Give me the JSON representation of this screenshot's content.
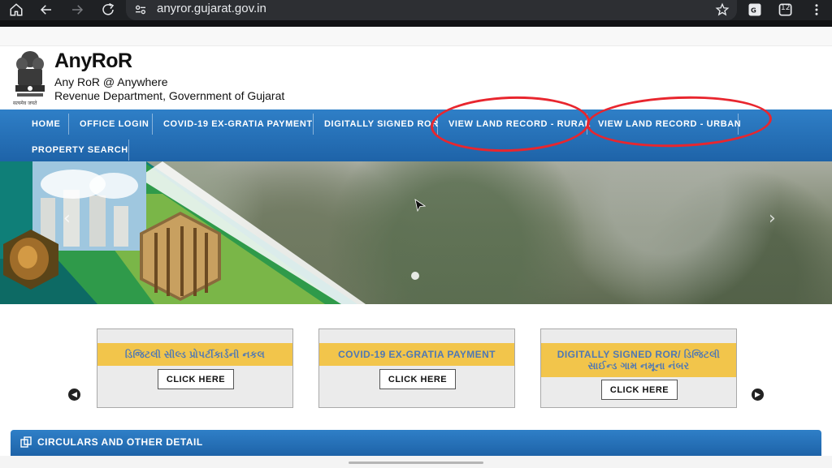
{
  "browser": {
    "url": "anyror.gujarat.gov.in",
    "tab_count": "12"
  },
  "header": {
    "title": "AnyRoR",
    "subtitle1": "Any RoR @ Anywhere",
    "subtitle2": "Revenue Department, Government of Gujarat",
    "emblem_caption": "सत्यमेव जयते"
  },
  "nav": {
    "items": [
      {
        "label": "HOME"
      },
      {
        "label": "OFFICE LOGIN"
      },
      {
        "label": "COVID-19 EX-GRATIA PAYMENT"
      },
      {
        "label": "DIGITALLY SIGNED ROR"
      },
      {
        "label": "VIEW LAND RECORD - RURAL"
      },
      {
        "label": "VIEW LAND RECORD - URBAN"
      },
      {
        "label": "PROPERTY SEARCH"
      }
    ],
    "highlight_color": "#e8262e"
  },
  "banner": {
    "prev_icon": "chevron-left-icon",
    "next_icon": "chevron-right-icon"
  },
  "cards": [
    {
      "title": "ડિજિટલી સીલ્ડ પ્રોપર્ટીકાર્ડની નકલ",
      "button": "CLICK HERE"
    },
    {
      "title": "COVID-19 EX-GRATIA PAYMENT",
      "button": "CLICK HERE"
    },
    {
      "title": "DIGITALLY SIGNED ROR/ ડિજિટલી સાઈન્ડ ગામ નમૂના નંબર",
      "button": "CLICK HERE"
    }
  ],
  "circulars": {
    "title": "CIRCULARS AND OTHER DETAIL"
  },
  "colors": {
    "nav_blue": "#2f7fc7",
    "card_band": "#f2c54b",
    "card_text": "#4f78b4"
  }
}
